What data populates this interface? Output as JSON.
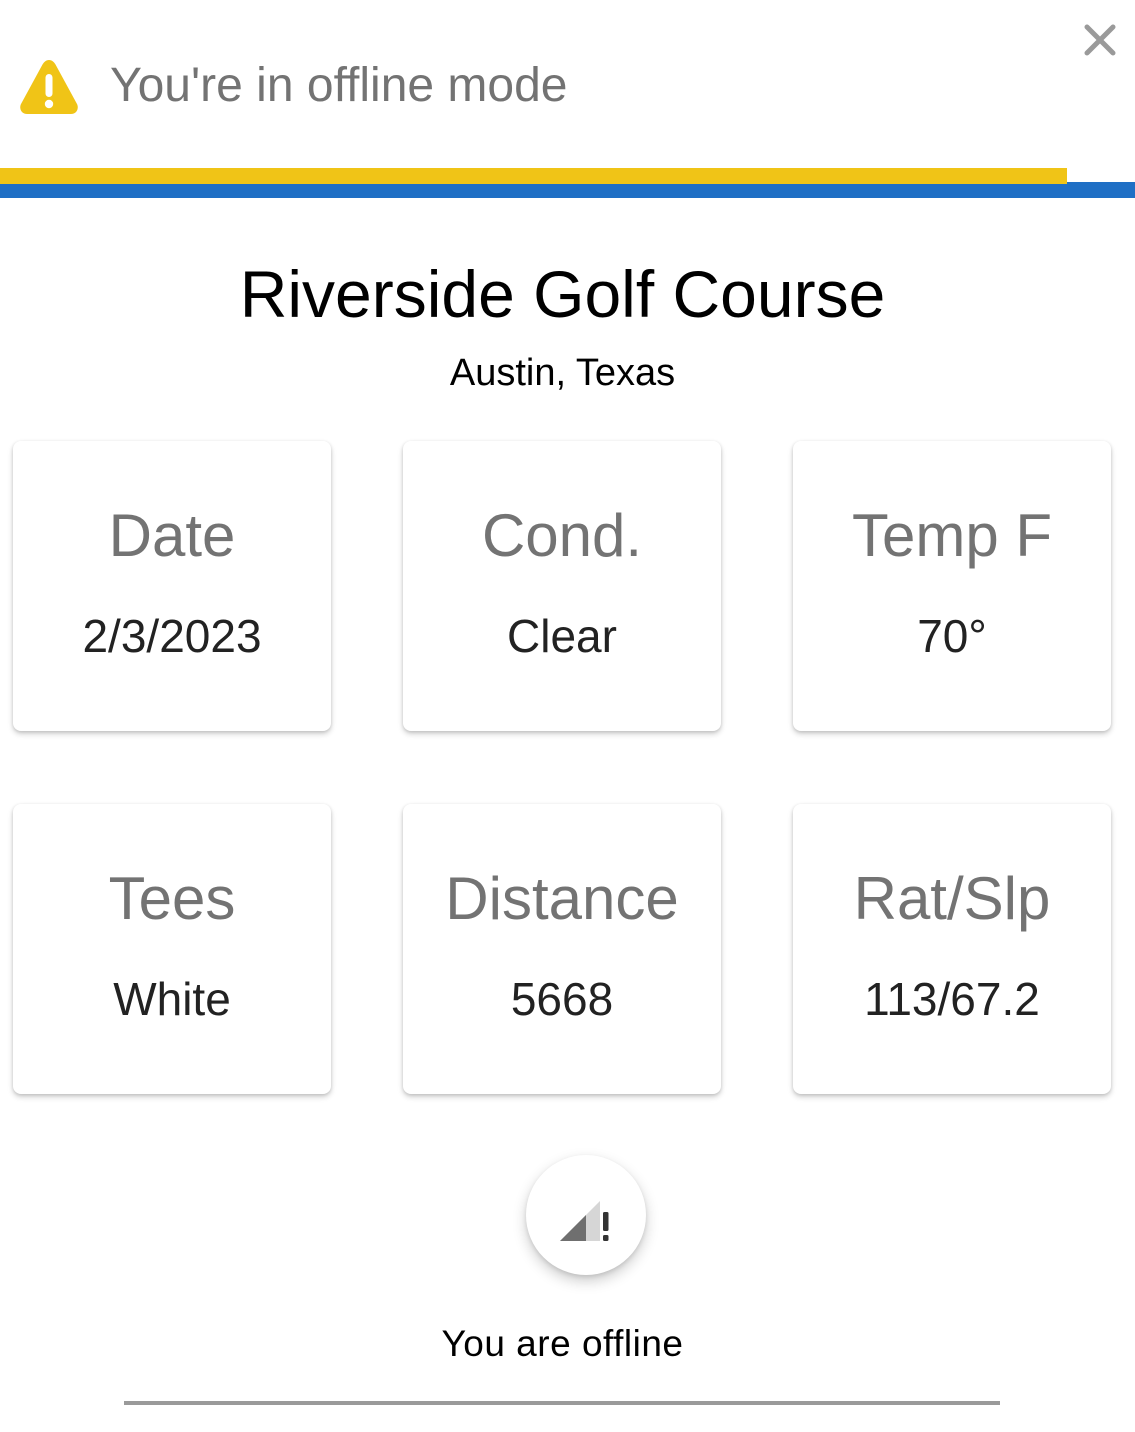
{
  "banner": {
    "message": "You're in offline mode",
    "icon": "warning-triangle-icon",
    "close_icon": "close-icon",
    "progress_fraction": 0.94,
    "colors": {
      "warning": "#f0c417",
      "accent_blue": "#1f6fc5"
    }
  },
  "course": {
    "name": "Riverside Golf Course",
    "location": "Austin, Texas"
  },
  "stats": [
    {
      "label": "Date",
      "value": "2/3/2023"
    },
    {
      "label": "Cond.",
      "value": "Clear"
    },
    {
      "label": "Temp F",
      "value": "70°"
    },
    {
      "label": "Tees",
      "value": "White"
    },
    {
      "label": "Distance",
      "value": "5668"
    },
    {
      "label": "Rat/Slp",
      "value": "113/67.2"
    }
  ],
  "status": {
    "icon": "signal-offline-icon",
    "text": "You are offline"
  }
}
